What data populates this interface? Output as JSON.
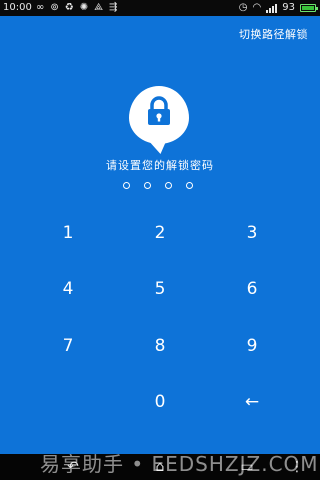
{
  "statusbar": {
    "time": "10:00",
    "battery_text": "93",
    "left_icons": [
      "infinity-icon",
      "sync-icon",
      "recycle-icon",
      "swirl-icon",
      "network-icon",
      "usb-icon"
    ],
    "right_icons": [
      "alarm-icon",
      "wifi-icon",
      "signal-icon",
      "battery-icon"
    ]
  },
  "header": {
    "switch_label": "切换路径解锁"
  },
  "lock": {
    "icon": "padlock-icon",
    "badge_color": "#ffffff",
    "accent": "#0e73d8"
  },
  "prompt": {
    "text": "请设置您的解锁密码",
    "pin_length": 4,
    "entered": 0
  },
  "keypad": {
    "keys": [
      "1",
      "2",
      "3",
      "4",
      "5",
      "6",
      "7",
      "8",
      "9",
      "0",
      "←"
    ]
  },
  "navbar": {
    "buttons": [
      {
        "name": "back-icon",
        "glyph": "↶"
      },
      {
        "name": "home-icon",
        "glyph": "⌂"
      },
      {
        "name": "recents-icon",
        "glyph": "▭"
      },
      {
        "name": "menu-icon",
        "glyph": "⋮"
      }
    ]
  },
  "watermark": "易享助手 • EEDSHZJZ.COM",
  "colors": {
    "background": "#0e73d8",
    "statusbar": "#0a0a0a",
    "navbar": "#050505"
  }
}
